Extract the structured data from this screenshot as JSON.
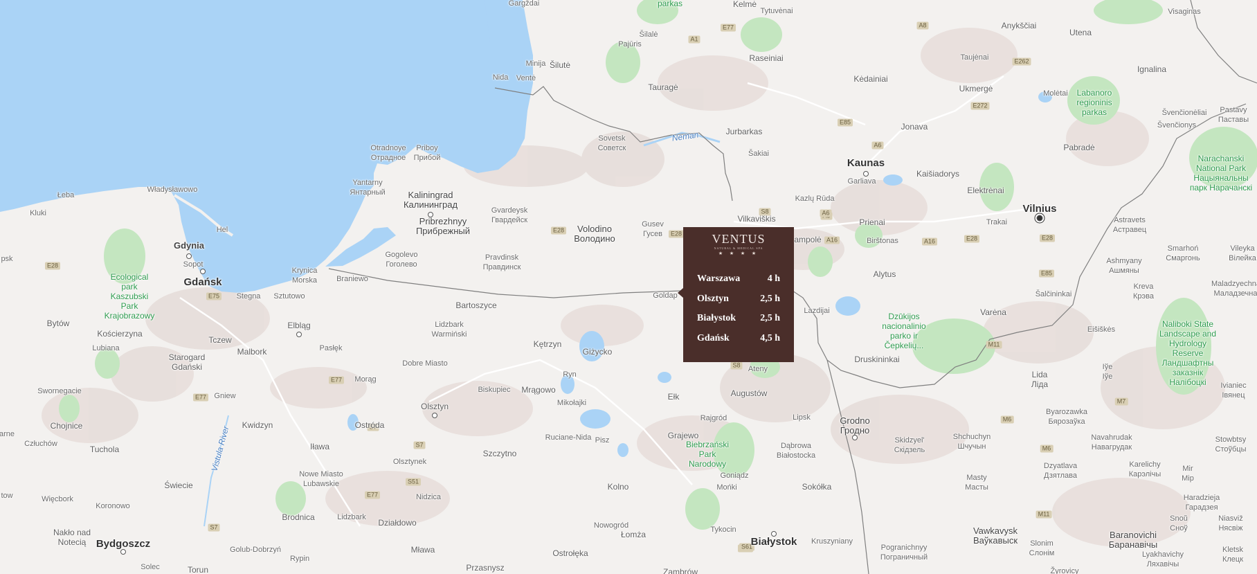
{
  "hotel": {
    "logo_text": "VENTUS",
    "logo_tagline": "natural & medical spa",
    "stars": "★ ★ ★ ★",
    "travel_times": [
      {
        "city": "Warszawa",
        "time": "4 h"
      },
      {
        "city": "Olsztyn",
        "time": "2,5 h"
      },
      {
        "city": "Białystok",
        "time": "2,5 h"
      },
      {
        "city": "Gdańsk",
        "time": "4,5 h"
      }
    ]
  },
  "labels": {
    "gargzdai": "Gargždai",
    "parkas_top": "parkas",
    "kelme": "Kelmė",
    "tytuvenai": "Tytuvėnai",
    "visaginas": "Visaginas",
    "anyksciai": "Anykščiai",
    "utena": "Utena",
    "pajuris": "Pajūris",
    "silale": "Šilalė",
    "raseiniai": "Raseiniai",
    "taujenai": "Taujėnai",
    "ignalina": "Ignalina",
    "minija": "Minija",
    "silute": "Šilutė",
    "nida": "Nida",
    "vente": "Ventė",
    "taurage": "Tauragė",
    "kedainiai": "Kėdainiai",
    "ukmerge": "Ukmergė",
    "moletai": "Molėtai",
    "labanoro": "Labanoro regioninis parkas",
    "svencioneliai": "Švenčionėliai",
    "svencionys": "Švenčionys",
    "pastavy": "Pastavy Паставы",
    "sovetsk": "Sovetsk Советск",
    "neman": "Neman",
    "jurbarkas": "Jurbarkas",
    "jonava": "Jonava",
    "pabrade": "Pabradė",
    "otradnoye": "Otradnoye Отрадное",
    "priboy": "Priboy Прибой",
    "sakiai": "Šakiai",
    "kaunas": "Kaunas",
    "kaisiadorys": "Kaišiadorys",
    "elektrenai": "Elektrėnai",
    "narachanski": "Narachanski National Park Нацыянальны парк Нарачанскі",
    "garliava": "Garliava",
    "vilnius": "Vilnius",
    "yantarny": "Yantarny Янтарный",
    "kaliningrad": "Kaliningrad Калининград",
    "gvardeysk": "Gvardeysk Гвардейск",
    "kazlu_ruda": "Kazlų Rūda",
    "vilkaviskis": "Vilkaviškis",
    "prienai": "Prienai",
    "trakai": "Trakai",
    "astravets": "Astravets Астравец",
    "smarhon": "Smarhoń Смаргонь",
    "vileyka": "Vileyka Вілейка",
    "pribrezhnyy": "Pribrezhnyy Прибрежный",
    "volodino": "Volodino Володино",
    "gusev": "Gusev Гусев",
    "marijampole": "ampolė",
    "birstonas": "Birštonas",
    "ashmyany": "Ashmyany Ашмяны",
    "gogolevo": "Gogolevo Гоголево",
    "pravdinsk": "Pravdinsk Правдинск",
    "alytus": "Alytus",
    "krynica": "Krynica Morska",
    "braniewo": "Braniewo",
    "kreva": "Kreva Крэва",
    "maladzyechna": "Maladzyechna Маладзечна",
    "goldap": "Goldap",
    "lazdijai": "Lazdijai",
    "salcininkai": "Šalčininkai",
    "stegna": "Stegna",
    "sztutowo": "Sztutowo",
    "bartoszyce": "Bartoszyce",
    "varena": "Varėna",
    "dzukijos": "Dzūkijos nacionalinio parko ir Čepkelių...",
    "eisiskes": "Eišiškės",
    "elblag": "Elbląg",
    "lidzbark_w": "Lidzbark Warmiński",
    "druskininkai": "Druskininkai",
    "ketrzyn": "Kętrzyn",
    "gizycko": "Giżycko",
    "paslek": "Pasłęk",
    "dobre_miasto": "Dobre Miasto",
    "naliboki": "Naliboki State Landscape and Hydrology Reserve Ландшафтны заказнік Налібоцкі",
    "ateny": "Ateny",
    "lida": "Lida Ліда",
    "iuje": "Іўе Іўе",
    "morag": "Morąg",
    "ryn": "Ryn",
    "biskupiec": "Biskupiec",
    "mragowo": "Mrągowo",
    "augustow": "Augustów",
    "ivianiec": "Ivianiec Івянец",
    "mikolajki": "Mikołajki",
    "elk": "Ełk",
    "olsztyn": "Olsztyn",
    "lipsk": "Lipsk",
    "grodno": "Grodno Гродно",
    "byarozauka": "Byarozawka Бярозаўка",
    "rajgrod": "Rajgród",
    "ostroda": "Ostróda",
    "grajewo": "Grajewo",
    "ruciane": "Ruciane-Nida",
    "pisz": "Pisz",
    "biebrzanski": "Biebrzański Park Narodowy",
    "dabrowa": "Dąbrowa Białostocka",
    "skidzyel": "Skidzyel' Скідзель",
    "shchuchyn": "Shchuchyn Шчучын",
    "navahrudak": "Navahrudak Навагрудак",
    "stowbtsy": "Stowbtsy Стоўбцы",
    "olsztynek": "Olsztynek",
    "szczytno": "Szczytno",
    "goniadz": "Goniądz",
    "karelichy": "Karelichy Карэлічы",
    "mir": "Mir Мір",
    "dzyatlava": "Dzyatlava Дзятлава",
    "nidzica": "Nidzica",
    "masty": "Masty Масты",
    "monki": "Mońki",
    "kolno": "Kolno",
    "sokolka": "Sokółka",
    "haradzieja": "Haradzieja Гарадзея",
    "dzialdowo": "Działdowo",
    "snou": "Snoŭ Снoў",
    "niasviz": "Niasviž Нясвіж",
    "nowogrod": "Nowogród",
    "tykocin": "Tykocin",
    "vawkavysk": "Vawkavysk Ваўкавыск",
    "baranovichi": "Baranovichi Барaнавічы",
    "lomza": "Łomża",
    "bialystok": "Białystok",
    "kruszyniany": "Kruszyniany",
    "slonim": "Slonim Слонім",
    "klietsk": "Kletsk Клецк",
    "pogranichnyy": "Pogranichnyy Пограничный",
    "lyakhavichy": "Lyakhavichy Ляхавічы",
    "mlawa": "Mława",
    "ostroleka": "Ostrołęka",
    "przasnysz": "Przasnysz",
    "zambrow": "Zambrów",
    "zyrovicy": "Žyrovicy",
    "leba": "Łeba",
    "wladyslawowo": "Władysławowo",
    "kluki": "Kluki",
    "hel": "Hel",
    "gdynia": "Gdynia",
    "sopot": "Sopot",
    "gdansk": "Gdańsk",
    "ecological": "Ecological park Kaszubski Park Krajobrazowy",
    "bytow": "Bytów",
    "koscierzyna": "Kościerzyna",
    "lubiana": "Lubiana",
    "tczew": "Tczew",
    "malbork": "Malbork",
    "starogard": "Starogard Gdański",
    "swornegacie": "Swornegacie",
    "gniew": "Gniew",
    "chojnice": "Chojnice",
    "kwidzyn": "Kwidzyn",
    "vistula": "Vistula River",
    "czluchow": "Człuchów",
    "tuchola": "Tuchola",
    "ilawa": "Iława",
    "swiecie": "Świecie",
    "nowe_miasto": "Nowe Miasto Lubawskie",
    "wiecbork": "Więcbork",
    "koronowo": "Koronowo",
    "brodnica": "Brodnica",
    "lidzbark": "Lidzbark",
    "naklo": "Nakło nad Notecią",
    "bydgoszcz": "Bydgoszcz",
    "golub": "Golub-Dobrzyń",
    "rypin": "Rypin",
    "solec": "Solec",
    "torun": "Torun",
    "psk": "psk",
    "arne": "arne",
    "tow": "tow"
  },
  "roads": [
    "A1",
    "E77",
    "E85",
    "A6",
    "E262",
    "E272",
    "A8",
    "E28",
    "A5",
    "A16",
    "A16",
    "E28",
    "E28",
    "E85",
    "M11",
    "M6",
    "M7",
    "M6",
    "M11",
    "E28",
    "E28",
    "E77",
    "E77",
    "E75",
    "S7",
    "S7",
    "S51",
    "E77",
    "S7",
    "E75",
    "S61",
    "S8",
    "S8",
    "A6"
  ],
  "colors": {
    "land": "#f3f1ef",
    "water": "#aad3f6",
    "park": "#c4e6c0",
    "urban": "#e5dcd8",
    "info_bg": "#4a2e2a",
    "park_label": "#2e9b4e"
  }
}
